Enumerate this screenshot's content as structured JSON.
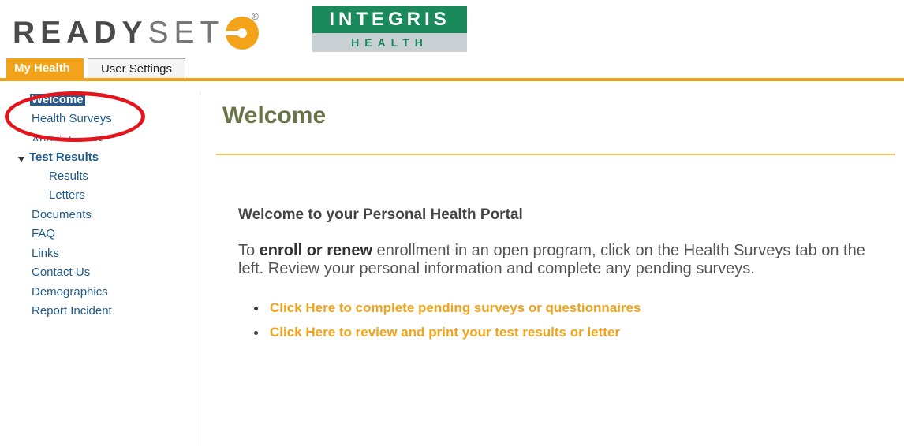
{
  "header": {
    "logo_text_bold": "READY",
    "logo_text_light": "SET",
    "logo_registered": "®",
    "partner_logo_top": "INTEGRIS",
    "partner_logo_bottom": "HEALTH"
  },
  "tabs": [
    {
      "label": "My Health",
      "active": true
    },
    {
      "label": "User Settings",
      "active": false
    }
  ],
  "sidebar": {
    "items": [
      {
        "label": "Welcome",
        "selected": true
      },
      {
        "label": "Health Surveys"
      },
      {
        "label": "Appointments"
      },
      {
        "label": "Test Results",
        "expanded": true
      },
      {
        "label": "Results"
      },
      {
        "label": "Letters"
      },
      {
        "label": "Documents"
      },
      {
        "label": "FAQ"
      },
      {
        "label": "Links"
      },
      {
        "label": "Contact Us"
      },
      {
        "label": "Demographics"
      },
      {
        "label": "Report Incident"
      }
    ]
  },
  "main": {
    "title": "Welcome",
    "heading": "Welcome to your Personal Health Portal",
    "intro_prefix": "To ",
    "intro_bold": "enroll or renew",
    "intro_suffix": " enrollment in an open program, click on the Health Surveys tab on the left. Review your personal information and complete any pending surveys.",
    "links": [
      "Click Here to complete pending surveys or questionnaires",
      "Click Here to review and print your test results or letter"
    ]
  },
  "colors": {
    "accent": "#f2a31a",
    "brand_green": "#1a8a5c",
    "nav_link": "#1f5a8c",
    "annotation": "#e3141b"
  }
}
